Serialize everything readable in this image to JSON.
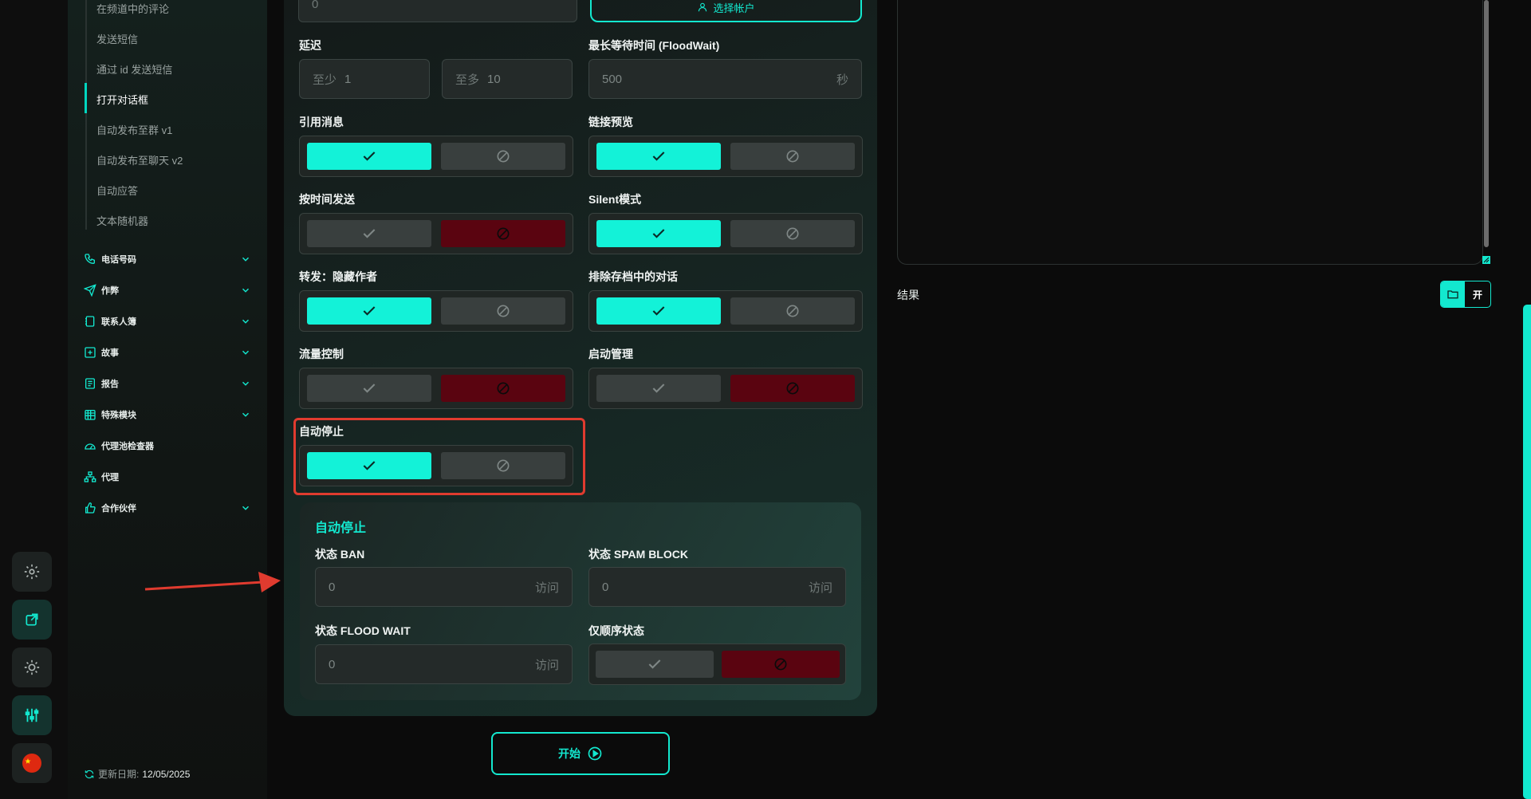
{
  "sidebar": {
    "sub_items": [
      "在频道中的评论",
      "发送短信",
      "通过 id 发送短信",
      "打开对话框",
      "自动发布至群 v1",
      "自动发布至聊天 v2",
      "自动应答",
      "文本随机器"
    ],
    "active_sub_item": "打开对话框",
    "nav": [
      {
        "label": "电话号码",
        "icon": "phone-icon",
        "expandable": true
      },
      {
        "label": "作弊",
        "icon": "send-icon",
        "expandable": true
      },
      {
        "label": "联系人簿",
        "icon": "contacts-icon",
        "expandable": true
      },
      {
        "label": "故事",
        "icon": "plus-square-icon",
        "expandable": true
      },
      {
        "label": "报告",
        "icon": "report-icon",
        "expandable": true
      },
      {
        "label": "特殊模块",
        "icon": "calendar-grid-icon",
        "expandable": true
      },
      {
        "label": "代理池检查器",
        "icon": "gauge-icon",
        "expandable": false
      },
      {
        "label": "代理",
        "icon": "network-icon",
        "expandable": false
      },
      {
        "label": "合作伙伴",
        "icon": "handshake-icon",
        "expandable": true
      }
    ],
    "update_label": "更新日期:",
    "update_date": "12/05/2025"
  },
  "rail": {
    "icons": [
      "gear-icon",
      "external-link-icon",
      "sun-icon",
      "sliders-icon",
      "china-flag-icon"
    ],
    "active": "sliders-icon"
  },
  "form": {
    "top_input_value": "0",
    "select_account": "选择帐户",
    "delay": {
      "label": "延迟",
      "min_prefix": "至少",
      "min_value": "1",
      "max_prefix": "至多",
      "max_value": "10"
    },
    "floodwait": {
      "label": "最长等待时间 (FloodWait)",
      "value": "500",
      "unit": "秒"
    },
    "toggles": {
      "quote": {
        "label": "引用消息",
        "state": "on"
      },
      "link_preview": {
        "label": "链接预览",
        "state": "on"
      },
      "schedule": {
        "label": "按时间发送",
        "state": "off"
      },
      "silent": {
        "label": "Silent模式",
        "state": "on"
      },
      "forward_hide": {
        "label": "转发：隐藏作者",
        "state": "on"
      },
      "exclude_archive": {
        "label": "排除存档中的对话",
        "state": "on"
      },
      "flow_control": {
        "label": "流量控制",
        "state": "off"
      },
      "startup_mgmt": {
        "label": "启动管理",
        "state": "off"
      },
      "auto_stop": {
        "label": "自动停止",
        "state": "on"
      }
    },
    "auto_stop_panel": {
      "title": "自动停止",
      "ban": {
        "label": "状态 BAN",
        "value": "0",
        "unit": "访问"
      },
      "spam": {
        "label": "状态 SPAM BLOCK",
        "value": "0",
        "unit": "访问"
      },
      "flood": {
        "label": "状态 FLOOD WAIT",
        "value": "0",
        "unit": "访问"
      },
      "sequential": {
        "label": "仅顺序状态",
        "state": "off"
      }
    },
    "start_button": "开始"
  },
  "results": {
    "label": "结果",
    "open_button": "开"
  },
  "colors": {
    "accent": "#13f2d8",
    "danger": "#5a0410",
    "annotation": "#e03b2f"
  }
}
